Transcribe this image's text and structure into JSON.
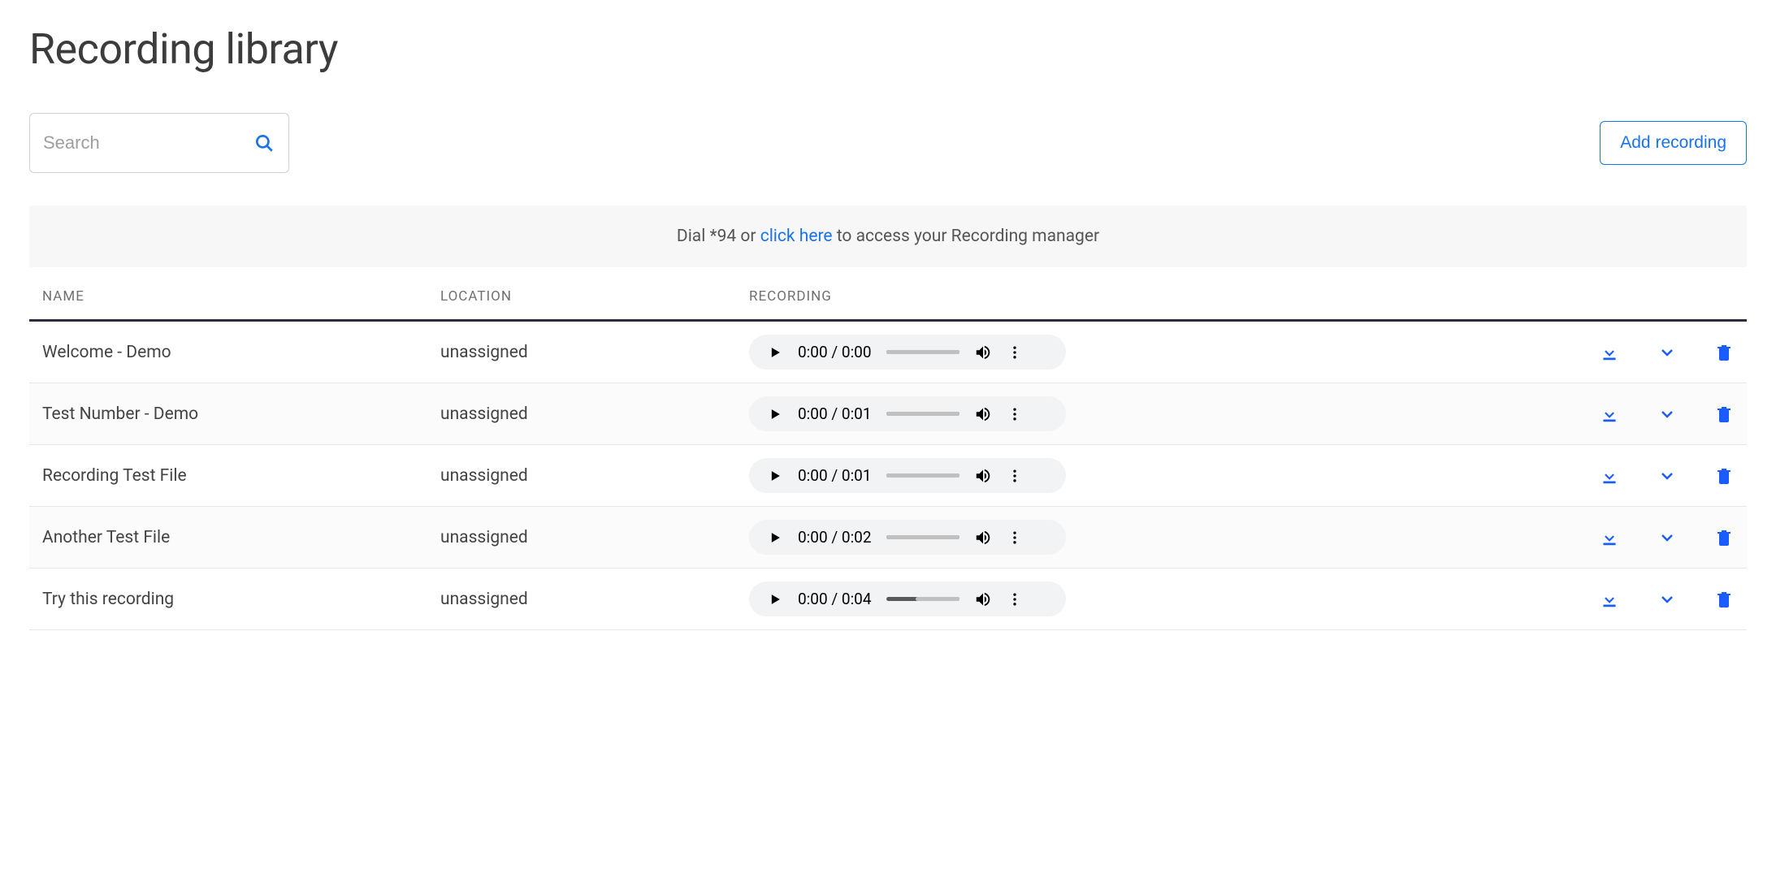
{
  "page": {
    "title": "Recording library",
    "search_placeholder": "Search",
    "add_button_label": "Add recording"
  },
  "banner": {
    "prefix": "Dial *94 or ",
    "link_text": "click here",
    "suffix": " to access your Recording manager"
  },
  "columns": {
    "name": "NAME",
    "location": "LOCATION",
    "recording": "RECORDING"
  },
  "rows": [
    {
      "name": "Welcome - Demo",
      "location": "unassigned",
      "current": "0:00",
      "duration": "0:00",
      "progress": 0
    },
    {
      "name": "Test Number - Demo",
      "location": "unassigned",
      "current": "0:00",
      "duration": "0:01",
      "progress": 0
    },
    {
      "name": "Recording Test File",
      "location": "unassigned",
      "current": "0:00",
      "duration": "0:01",
      "progress": 0
    },
    {
      "name": "Another Test File",
      "location": "unassigned",
      "current": "0:00",
      "duration": "0:02",
      "progress": 0
    },
    {
      "name": "Try this recording",
      "location": "unassigned",
      "current": "0:00",
      "duration": "0:04",
      "progress": 40
    }
  ]
}
